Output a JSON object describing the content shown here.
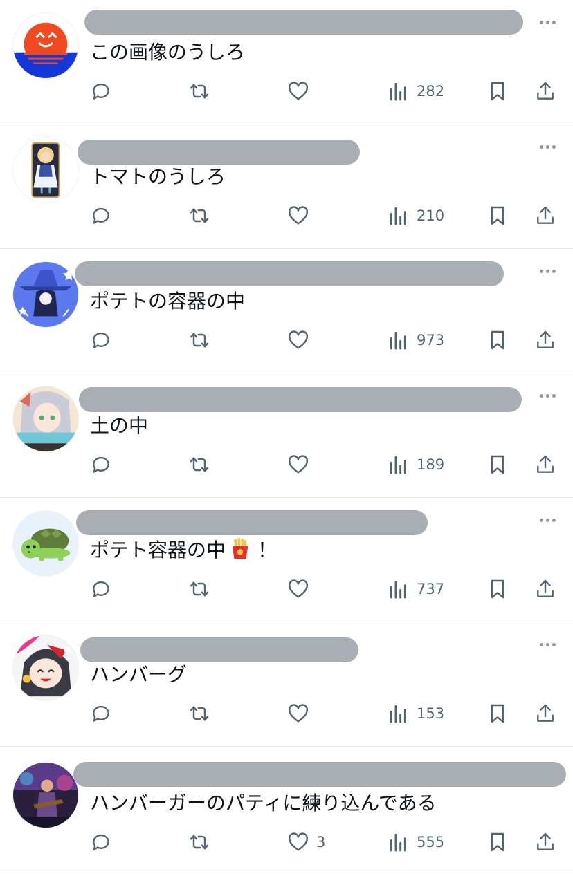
{
  "replies": [
    {
      "text": "この画像のうしろ",
      "likes": "",
      "views": "282",
      "avatar": "red-sun-smile-avatar"
    },
    {
      "text": "トマトのうしろ",
      "likes": "",
      "views": "210",
      "avatar": "anime-girl-tarot-avatar"
    },
    {
      "text": "ポテトの容器の中",
      "likes": "",
      "views": "973",
      "avatar": "blue-witch-avatar"
    },
    {
      "text": "土の中",
      "likes": "",
      "views": "189",
      "avatar": "anime-girl-silver-hair-avatar"
    },
    {
      "text": "ポテト容器の中",
      "text_suffix": "！",
      "emoji": "french-fries-emoji",
      "likes": "",
      "views": "737",
      "avatar": "green-turtle-avatar"
    },
    {
      "text": "ハンバーグ",
      "likes": "",
      "views": "153",
      "avatar": "anime-girl-santa-hat-avatar"
    },
    {
      "text": "ハンバーガーのパティに練り込んである",
      "likes": "3",
      "views": "555",
      "avatar": "guitarist-photo-avatar"
    }
  ],
  "colors": {
    "icon": "#536471",
    "text": "#0f1419",
    "redaction": "#a9aeb4",
    "divider": "#e6e9ec"
  }
}
